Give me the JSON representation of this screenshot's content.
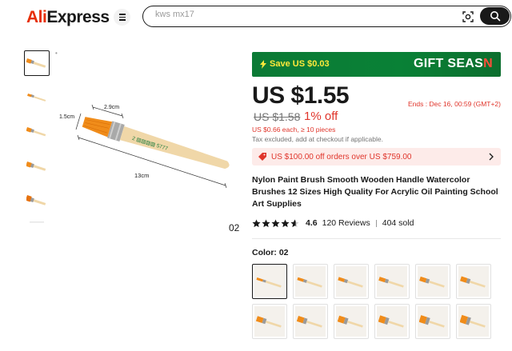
{
  "header": {
    "logo_ali": "Ali",
    "logo_express": "Express",
    "search_value": "kws mx17"
  },
  "gallery": {
    "thumb_count": 6,
    "caption": "02",
    "dims": {
      "width": "2.9cm",
      "height": "1.5cm",
      "length": "13cm"
    }
  },
  "promo": {
    "save": "Save US $0.03",
    "title_part1": "GIFT SEAS",
    "title_part2": "N"
  },
  "price": {
    "current": "US $1.55",
    "ends": "Ends :  Dec 16, 00:59 (GMT+2)",
    "original": "US $1.58",
    "discount": "1% off",
    "each": "US $0.66 each, ≥ 10 pieces",
    "tax": "Tax excluded, add at checkout if applicable."
  },
  "coupon": {
    "text": "US $100.00 off orders over US $759.00"
  },
  "product": {
    "title": "Nylon Paint Brush Smooth Wooden Handle Watercolor Brushes 12 Sizes High Quality For Acrylic Oil Painting School Art Supplies"
  },
  "rating": {
    "stars": 4.6,
    "value": "4.6",
    "reviews": "120 Reviews",
    "sold": "404 sold"
  },
  "variant": {
    "label": "Color:",
    "selected": "02",
    "swatch_count": 12,
    "selected_index": 0
  },
  "colors": {
    "accent": "#e0352b",
    "brand": "#e62e04",
    "promo_green": "#098136",
    "bristle": "#f08c1a",
    "handle": "#f0d7a8"
  }
}
